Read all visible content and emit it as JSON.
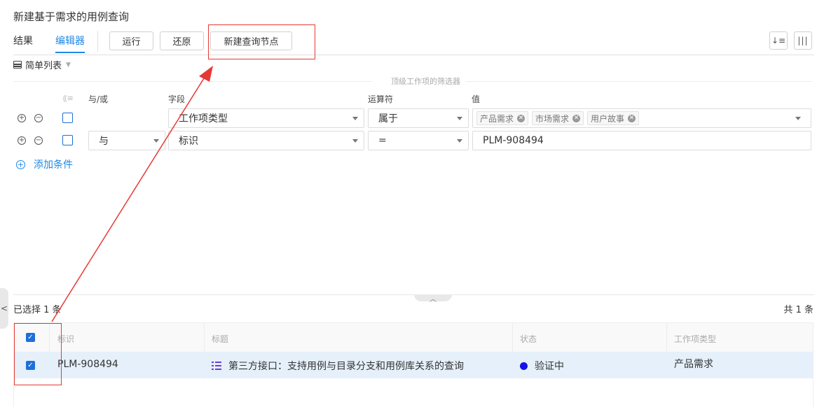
{
  "page": {
    "title": "新建基于需求的用例查询"
  },
  "tabs": [
    {
      "label": "结果",
      "active": false
    },
    {
      "label": "编辑器",
      "active": true
    }
  ],
  "toolbar": {
    "run_label": "运行",
    "restore_label": "还原",
    "new_node_label": "新建查询节点"
  },
  "view": {
    "label": "简单列表"
  },
  "filter": {
    "caption": "顶级工作项的筛选器",
    "headers": {
      "andor": "与/或",
      "field": "字段",
      "operator": "运算符",
      "value": "值"
    },
    "rows": [
      {
        "andor": "",
        "field": "工作项类型",
        "operator": "属于",
        "value_tags": [
          "产品需求",
          "市场需求",
          "用户故事"
        ]
      },
      {
        "andor": "与",
        "field": "标识",
        "operator": "=",
        "value": "PLM-908494"
      }
    ],
    "add_condition_label": "添加条件"
  },
  "results": {
    "selected_text": "已选择 1 条",
    "total_text": "共 1 条",
    "columns": [
      "标识",
      "标题",
      "状态",
      "工作项类型"
    ],
    "rows": [
      {
        "id": "PLM-908494",
        "title": "第三方接口：支持用例与目录分支和用例库关系的查询",
        "status": "验证中",
        "type": "产品需求",
        "checked": true
      }
    ]
  },
  "colors": {
    "accent": "#1e88e5",
    "checkbox": "#1e6fd9",
    "row_highlight": "#e6f0fb",
    "status_dot": "#1414e6",
    "annotation": "#e53935",
    "story_icon": "#6a3fd6"
  }
}
